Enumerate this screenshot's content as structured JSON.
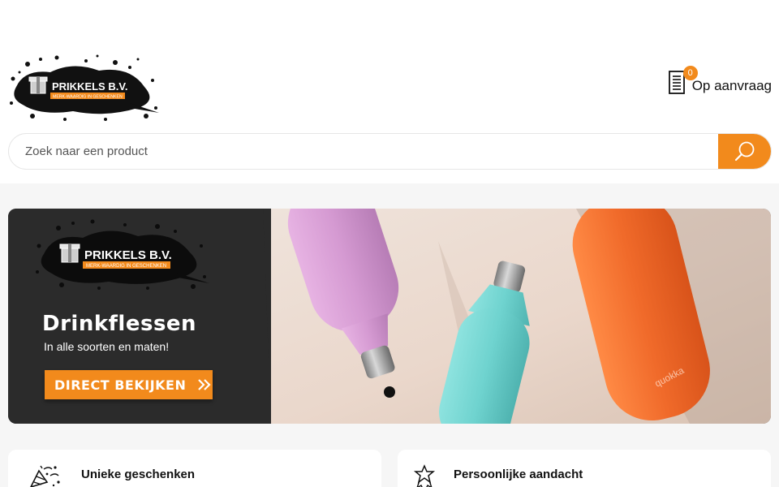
{
  "brand": {
    "name": "PRIKKELS B.V.",
    "tagline": "MERK-WAARDIG IN GESCHENKEN"
  },
  "header": {
    "cart_count": "0",
    "cart_label": "Op aanvraag"
  },
  "search": {
    "placeholder": "Zoek naar een product"
  },
  "banner": {
    "title": "Drinkflessen",
    "subtitle": "In alle soorten en maten!",
    "cta_label": "DIRECT BEKIJKEN",
    "cta_arrow": "»",
    "bottle_brand": "quokka",
    "slide_current": 1,
    "slide_total": 1
  },
  "features": [
    {
      "title": "Unieke geschenken",
      "icon": "confetti-icon"
    },
    {
      "title": "Persoonlijke aandacht",
      "icon": "badge-star-icon"
    }
  ],
  "colors": {
    "accent": "#f28a1c",
    "banner_dark": "#2b2b2b",
    "bottle_pink": "#d59ad2",
    "bottle_teal": "#6fd3cf",
    "bottle_orange": "#f06a2a"
  }
}
